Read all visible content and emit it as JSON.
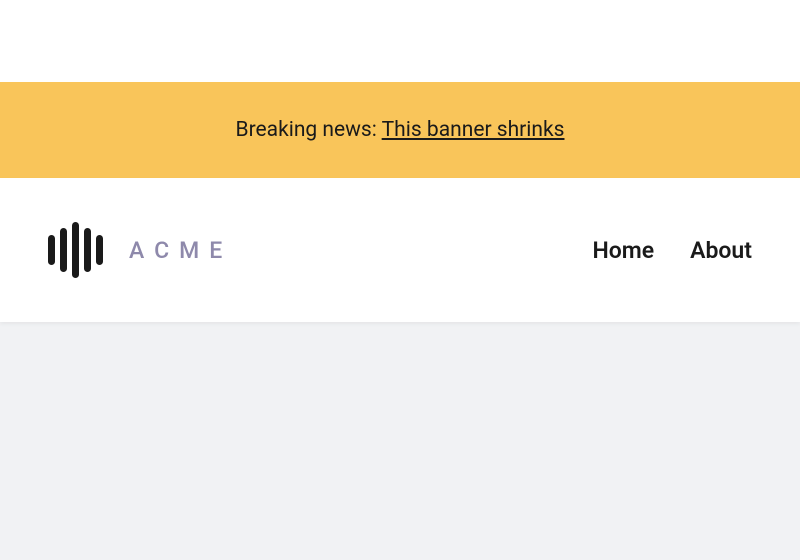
{
  "banner": {
    "prefix": "Breaking news: ",
    "link_text": "This banner shrinks"
  },
  "brand": {
    "name": "ACME"
  },
  "nav": {
    "home": "Home",
    "about": "About"
  }
}
